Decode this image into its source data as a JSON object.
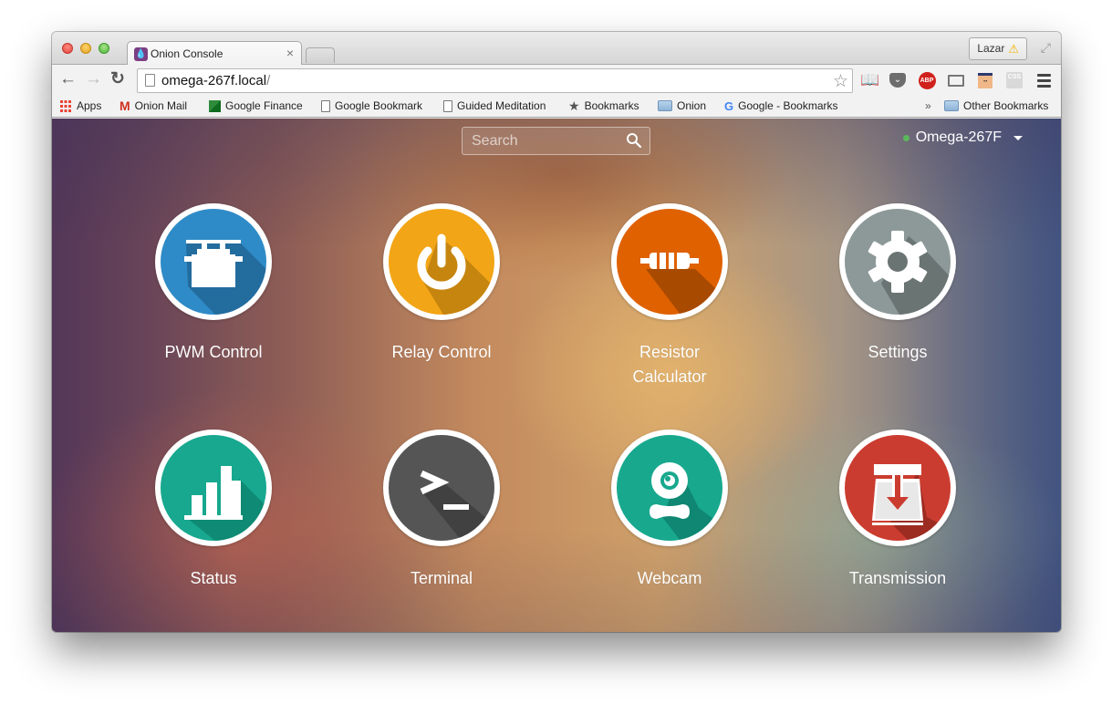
{
  "browser": {
    "tab": {
      "title": "Onion Console",
      "favicon": "onion-logo-icon"
    },
    "profile": {
      "name": "Lazar",
      "icon": "warning-icon"
    },
    "url": {
      "host": "omega-267f.local",
      "path": "/"
    },
    "extensions": [
      "readability-book-icon",
      "pocket-icon",
      "adblock-plus-icon",
      "cast-icon",
      "face-extension-icon",
      "css-viewer-icon",
      "menu-icon"
    ],
    "bookmarks": [
      {
        "label": "Apps",
        "icon": "apps-grid-icon"
      },
      {
        "label": "Onion Mail",
        "icon": "gmail-icon"
      },
      {
        "label": "Google Finance",
        "icon": "finance-icon"
      },
      {
        "label": "Google Bookmark",
        "icon": "page-icon"
      },
      {
        "label": "Guided Meditation",
        "icon": "page-icon"
      },
      {
        "label": "Bookmarks",
        "icon": "star-icon"
      },
      {
        "label": "Onion",
        "icon": "folder-icon"
      },
      {
        "label": "Google - Bookmarks",
        "icon": "google-icon"
      }
    ],
    "overflow": "»",
    "other_bookmarks": "Other Bookmarks"
  },
  "page": {
    "search": {
      "placeholder": "Search",
      "value": ""
    },
    "device": {
      "name": "Omega-267F",
      "status_color": "#5cb85c"
    },
    "apps": [
      {
        "label": "PWM Control",
        "icon": "servo-icon",
        "color": "#2f8bc7"
      },
      {
        "label": "Relay Control",
        "icon": "power-icon",
        "color": "#f2a516"
      },
      {
        "label": "Resistor Calculator",
        "icon": "resistor-icon",
        "color": "#df6100"
      },
      {
        "label": "Settings",
        "icon": "gear-icon",
        "color": "#8c9998"
      },
      {
        "label": "Status",
        "icon": "bar-chart-icon",
        "color": "#17a88f"
      },
      {
        "label": "Terminal",
        "icon": "terminal-icon",
        "color": "#555555"
      },
      {
        "label": "Webcam",
        "icon": "webcam-icon",
        "color": "#18a88e"
      },
      {
        "label": "Transmission",
        "icon": "transmission-icon",
        "color": "#cb3c30"
      }
    ]
  }
}
